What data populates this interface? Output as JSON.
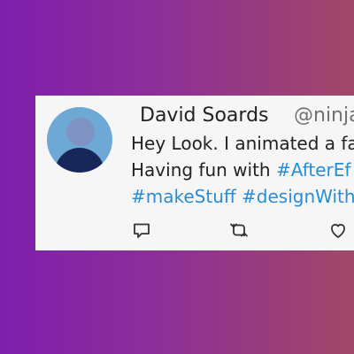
{
  "tweet": {
    "author_name": "David Soards",
    "author_handle": "@ninja",
    "line1": "Hey Look. I animated a fa",
    "line2_text": "Having fun with ",
    "line2_tag": "#AfterEf",
    "line3_tag1": "#makeStuff",
    "line3_sep": " ",
    "line3_tag2": "#designWithI"
  },
  "colors": {
    "hashtag": "#2a8dd4",
    "background_gradient_start": "#7f1fae",
    "background_gradient_end": "#a24767",
    "card": "#f6f6f6",
    "avatar_bg": "#6ea8d4"
  },
  "actions": {
    "reply_icon": "reply-icon",
    "retweet_icon": "retweet-icon",
    "like_icon": "heart-icon"
  }
}
